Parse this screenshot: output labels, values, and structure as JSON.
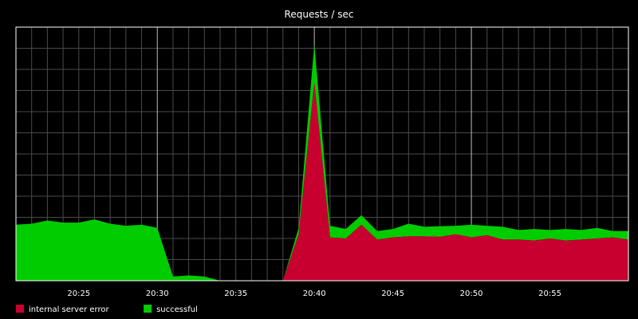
{
  "chart_data": {
    "type": "area",
    "stacked": true,
    "title": "Requests / sec",
    "xlabel": "",
    "ylabel": "",
    "x_tick_labels": [
      "20:25",
      "20:30",
      "20:35",
      "20:40",
      "20:45",
      "20:50",
      "20:55"
    ],
    "x_tick_minutes": [
      25,
      30,
      35,
      40,
      45,
      50,
      55
    ],
    "x": [
      "20:21",
      "20:22",
      "20:23",
      "20:24",
      "20:25",
      "20:26",
      "20:27",
      "20:28",
      "20:29",
      "20:30",
      "20:31",
      "20:32",
      "20:33",
      "20:34",
      "20:35",
      "20:36",
      "20:37",
      "20:38",
      "20:39",
      "20:40",
      "20:41",
      "20:42",
      "20:43",
      "20:44",
      "20:45",
      "20:46",
      "20:47",
      "20:48",
      "20:49",
      "20:50",
      "20:51",
      "20:52",
      "20:53",
      "20:54",
      "20:55",
      "20:56",
      "20:57",
      "20:58",
      "20:59",
      "21:00"
    ],
    "x_minutes": [
      21,
      22,
      23,
      24,
      25,
      26,
      27,
      28,
      29,
      30,
      31,
      32,
      33,
      34,
      35,
      36,
      37,
      38,
      39,
      40,
      41,
      42,
      43,
      44,
      45,
      46,
      47,
      48,
      49,
      50,
      51,
      52,
      53,
      54,
      55,
      56,
      57,
      58,
      59,
      60
    ],
    "xlim_minutes": [
      21,
      60
    ],
    "ylim": [
      0,
      12
    ],
    "y_grid_step": 1,
    "grid": true,
    "y_tick_labels_shown": false,
    "legend_position": "bottom-left",
    "series": [
      {
        "name": "internal server error",
        "color": "#c8002f",
        "values": [
          0,
          0,
          0,
          0,
          0,
          0,
          0,
          0,
          0,
          0,
          0,
          0,
          0,
          0,
          0,
          0,
          0,
          0,
          2.2,
          9.4,
          2.05,
          2.0,
          2.65,
          1.95,
          2.05,
          2.1,
          2.1,
          2.08,
          2.2,
          2.05,
          2.15,
          1.95,
          1.95,
          1.9,
          2.0,
          1.9,
          1.95,
          2.0,
          2.05,
          1.95
        ]
      },
      {
        "name": "successful",
        "color": "#00cc00",
        "values": [
          2.65,
          2.7,
          2.85,
          2.75,
          2.75,
          2.9,
          2.7,
          2.6,
          2.65,
          2.5,
          0.2,
          0.25,
          0.2,
          0,
          0,
          0,
          0,
          0,
          0.3,
          1.8,
          0.55,
          0.45,
          0.45,
          0.4,
          0.4,
          0.6,
          0.45,
          0.5,
          0.4,
          0.6,
          0.45,
          0.6,
          0.45,
          0.55,
          0.4,
          0.55,
          0.45,
          0.5,
          0.3,
          0.4
        ]
      }
    ]
  }
}
